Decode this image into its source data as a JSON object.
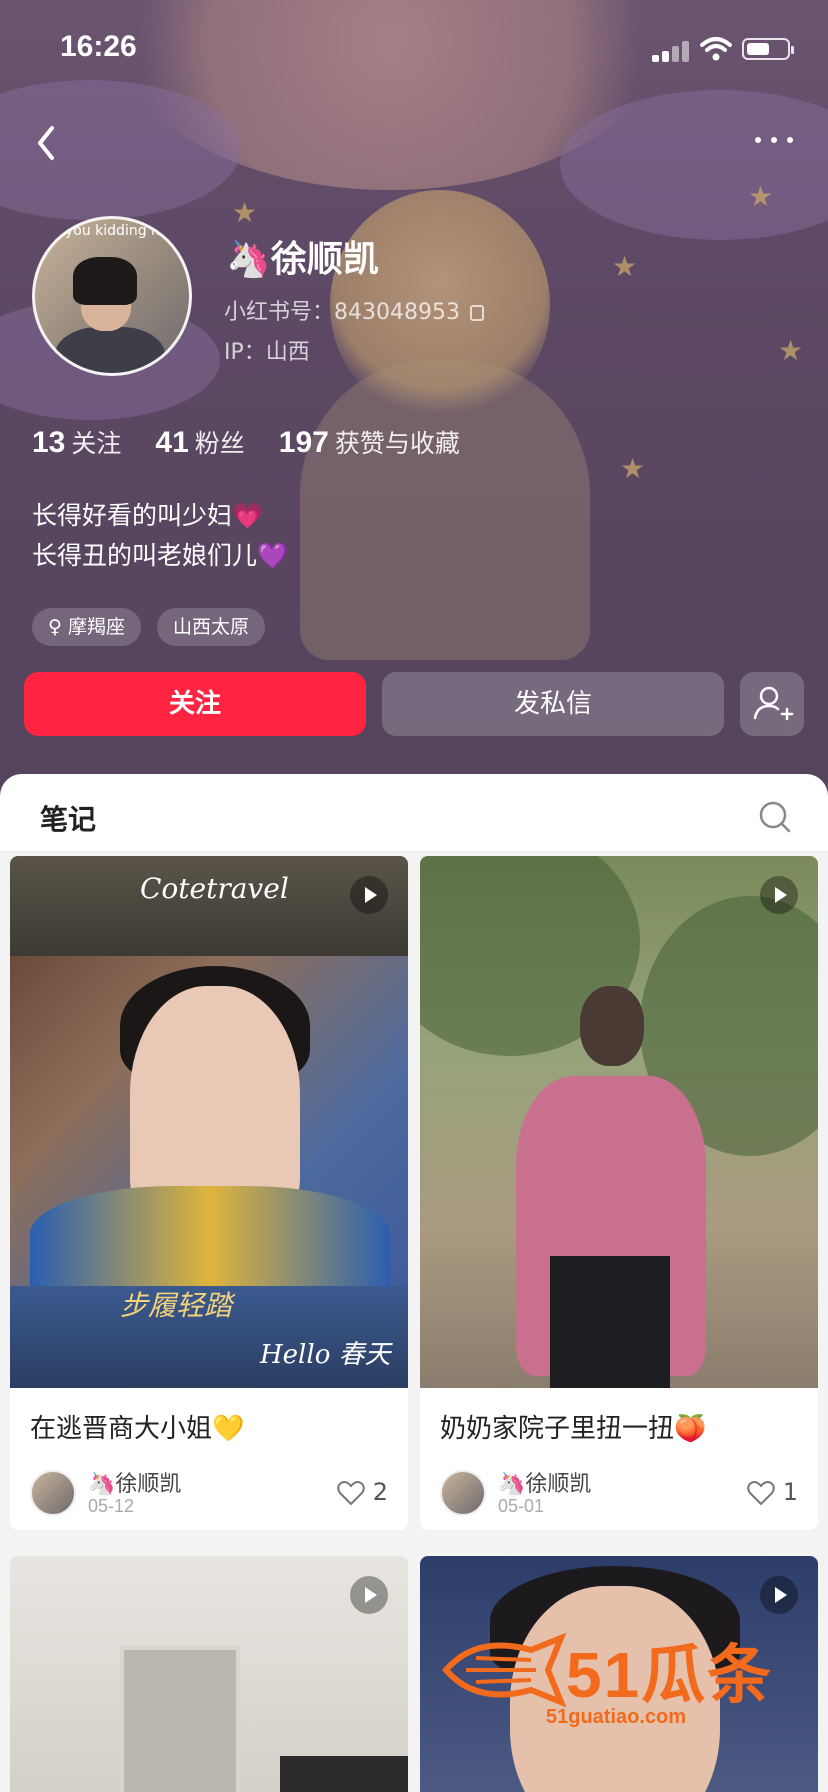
{
  "status_bar": {
    "time": "16:26"
  },
  "profile": {
    "name": "🦄徐顺凯",
    "red_id": "小红书号：843048953",
    "ip": "IP：山西",
    "avatar_caption": "you kidding me",
    "stats": [
      {
        "num": "13",
        "label": "关注"
      },
      {
        "num": "41",
        "label": "粉丝"
      },
      {
        "num": "197",
        "label": "获赞与收藏"
      }
    ],
    "bio_lines": [
      "长得好看的叫少妇💗",
      "长得丑的叫老娘们儿💜"
    ],
    "tags": [
      "♀ 摩羯座",
      "山西太原"
    ]
  },
  "actions": {
    "follow": "关注",
    "message": "发私信"
  },
  "tabs": {
    "notes": "笔记"
  },
  "cards": [
    {
      "title": "在逃晋商大小姐💛",
      "author": "🦄徐顺凯",
      "date": "05-12",
      "likes": "2",
      "img_text_top": "Cotetravel",
      "img_text_mid": "步履轻踏",
      "img_text_bot": "Hello 春天"
    },
    {
      "title": "奶奶家院子里扭一扭🍑",
      "author": "🦄徐顺凯",
      "date": "05-01",
      "likes": "1"
    }
  ],
  "watermark": {
    "main": "51瓜条",
    "sub": "51guatiao.com"
  },
  "colors": {
    "accent": "#ff2442",
    "watermark": "#f26a1b"
  }
}
